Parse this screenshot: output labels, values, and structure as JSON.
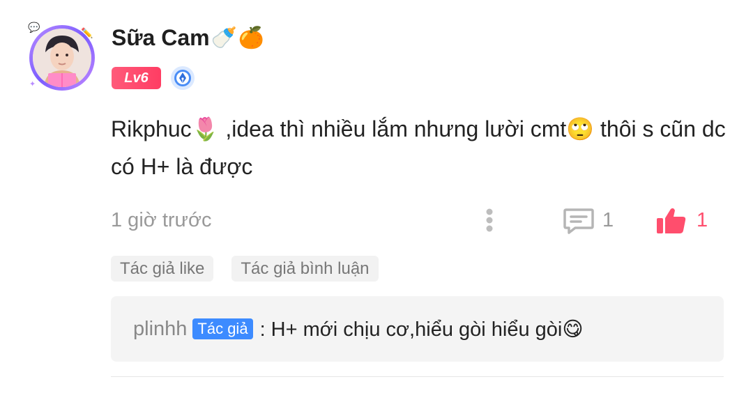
{
  "user": {
    "name": "Sữa Cam",
    "name_emojis": [
      "🍼",
      "🍊"
    ],
    "level": "Lv6",
    "avatar_icon": "user-avatar",
    "badge_icon": "pen-nib-badge-icon"
  },
  "comment": {
    "text": "Rikphuc🌷 ,idea thì nhiều lắm nhưng lười cmt🙄 thôi s cũn dc có H+ là được",
    "time": "1 giờ trước",
    "reply_count": "1",
    "like_count": "1"
  },
  "tags": [
    "Tác giả like",
    "Tác giả bình luận"
  ],
  "reply": {
    "user": "plinhh",
    "author_label": "Tác giả",
    "text": ": H+ mới chịu cơ,hiểu gòi hiểu gòi😋"
  },
  "colors": {
    "accent_pink": "#ff4e6d",
    "author_blue": "#3d8bff",
    "muted_gray": "#999999"
  }
}
